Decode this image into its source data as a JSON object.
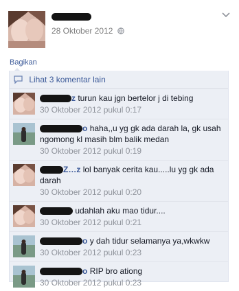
{
  "post": {
    "date": "28 Oktober 2012"
  },
  "share_label": "Bagikan",
  "view_more_label": "Lihat 3 komentar lain",
  "comments": [
    {
      "name_suffix": "z",
      "text": "turun kau jgn bertelor j di tebing",
      "time": "30 Oktober 2012 pukul 0:17"
    },
    {
      "name_suffix": "o",
      "text": "haha,,u yg gk ada darah la, gk usah ngomong kl masih blm balik medan",
      "time": "30 Oktober 2012 pukul 0:19"
    },
    {
      "name_suffix": "Z…z",
      "text": "lol banyak cerita kau.....lu yg gk ada darah",
      "time": "30 Oktober 2012 pukul 0:20"
    },
    {
      "name_suffix": "",
      "text": "udahlah aku mao tidur....",
      "time": "30 Oktober 2012 pukul 0:21"
    },
    {
      "name_suffix": "o",
      "text": "y dah tidur selamanya ya,wkwkw",
      "time": "30 Oktober 2012 pukul 0:23"
    },
    {
      "name_suffix": "o",
      "text": "RIP bro ationg",
      "time": "30 Oktober 2012 pukul 0:23"
    }
  ],
  "colors": {
    "link": "#3b5998",
    "comment_bg": "#eceff5",
    "timestamp": "#90949c"
  },
  "icons": {
    "privacy": "globe-icon",
    "menu": "chevron-down-icon",
    "comments": "comment-bubble-icon"
  }
}
